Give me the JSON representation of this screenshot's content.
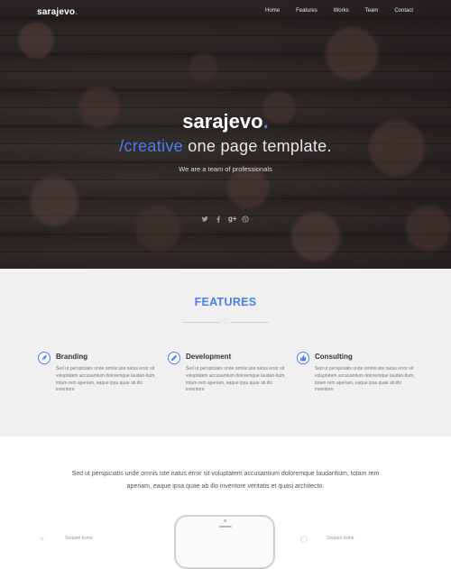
{
  "nav": {
    "brand": "sarajevo",
    "brand_dot": ".",
    "items": [
      "Home",
      "Features",
      "Works",
      "Team",
      "Contact"
    ]
  },
  "hero": {
    "title": "sarajevo",
    "title_dot": ".",
    "subtitle_accent": "/creative",
    "subtitle_rest": " one page template.",
    "tagline": "We are a team of professionals",
    "social_icons": [
      "twitter-icon",
      "facebook-icon",
      "google-plus-icon",
      "dribbble-icon"
    ]
  },
  "features": {
    "title": "FEATURES",
    "items": [
      {
        "heading": "Branding",
        "icon": "feather-icon",
        "text": "Sed ut perspiciatis unde omnis iste natus error sit voluptatem accusantium doloremque laudan-tium, totam rem aperiam, eaque ipsa quae ab illo inventore"
      },
      {
        "heading": "Development",
        "icon": "pencil-icon",
        "text": "Sed ut perspiciatis unde omnis iste natus error sit voluptatem accusantium doloremque laudan-tium, totam rem aperiam, eaque ipsa quae ab illo inventore"
      },
      {
        "heading": "Consulting",
        "icon": "thumbs-up-icon",
        "text": "Sed ut perspiciatis unde omnis iste natus error sit voluptatem accusantium doloremque laudan-tium, totam rem aperiam, eaque ipsa quae ab illo inventore"
      }
    ]
  },
  "about": {
    "text": "Sed ut perspiciatis unde omnis iste natus error sit voluptatem accusantium doloremque laudantium, totam rem aperiam, eaque ipsa quae ab illo inventore veritatis et quasi architecto.",
    "left_label": "Sequen tisme",
    "right_label": "Sequen tisme"
  },
  "colors": {
    "accent": "#4a7ef0",
    "features_bg": "#f0f0f0"
  }
}
